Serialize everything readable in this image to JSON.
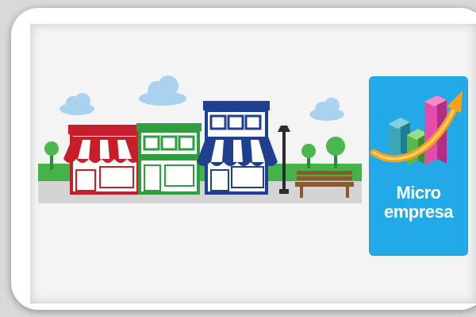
{
  "badge": {
    "line1": "Micro",
    "line2": "empresa",
    "background": "#22a9e8",
    "icon": "growth-chart-icon"
  },
  "scene": {
    "icon": "storefront-street-icon",
    "colors": {
      "red_shop": "#c81e2a",
      "green_shop": "#2e9e3f",
      "blue_shop": "#1f3f8f",
      "cloud": "#a9d2ee",
      "ground": "#d4d4d4",
      "grass": "#45b24a",
      "bench": "#8a5a2b"
    }
  }
}
